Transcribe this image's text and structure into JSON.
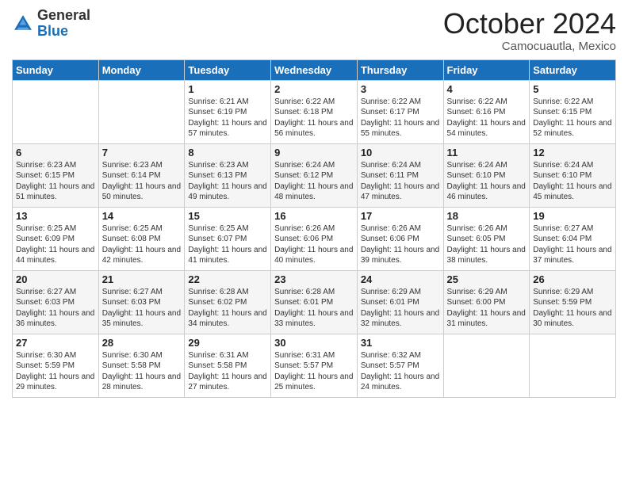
{
  "header": {
    "logo": {
      "general": "General",
      "blue": "Blue"
    },
    "month": "October 2024",
    "location": "Camocuautla, Mexico"
  },
  "weekdays": [
    "Sunday",
    "Monday",
    "Tuesday",
    "Wednesday",
    "Thursday",
    "Friday",
    "Saturday"
  ],
  "weeks": [
    [
      {
        "day": null
      },
      {
        "day": null
      },
      {
        "day": "1",
        "sunrise": "Sunrise: 6:21 AM",
        "sunset": "Sunset: 6:19 PM",
        "daylight": "Daylight: 11 hours and 57 minutes."
      },
      {
        "day": "2",
        "sunrise": "Sunrise: 6:22 AM",
        "sunset": "Sunset: 6:18 PM",
        "daylight": "Daylight: 11 hours and 56 minutes."
      },
      {
        "day": "3",
        "sunrise": "Sunrise: 6:22 AM",
        "sunset": "Sunset: 6:17 PM",
        "daylight": "Daylight: 11 hours and 55 minutes."
      },
      {
        "day": "4",
        "sunrise": "Sunrise: 6:22 AM",
        "sunset": "Sunset: 6:16 PM",
        "daylight": "Daylight: 11 hours and 54 minutes."
      },
      {
        "day": "5",
        "sunrise": "Sunrise: 6:22 AM",
        "sunset": "Sunset: 6:15 PM",
        "daylight": "Daylight: 11 hours and 52 minutes."
      }
    ],
    [
      {
        "day": "6",
        "sunrise": "Sunrise: 6:23 AM",
        "sunset": "Sunset: 6:15 PM",
        "daylight": "Daylight: 11 hours and 51 minutes."
      },
      {
        "day": "7",
        "sunrise": "Sunrise: 6:23 AM",
        "sunset": "Sunset: 6:14 PM",
        "daylight": "Daylight: 11 hours and 50 minutes."
      },
      {
        "day": "8",
        "sunrise": "Sunrise: 6:23 AM",
        "sunset": "Sunset: 6:13 PM",
        "daylight": "Daylight: 11 hours and 49 minutes."
      },
      {
        "day": "9",
        "sunrise": "Sunrise: 6:24 AM",
        "sunset": "Sunset: 6:12 PM",
        "daylight": "Daylight: 11 hours and 48 minutes."
      },
      {
        "day": "10",
        "sunrise": "Sunrise: 6:24 AM",
        "sunset": "Sunset: 6:11 PM",
        "daylight": "Daylight: 11 hours and 47 minutes."
      },
      {
        "day": "11",
        "sunrise": "Sunrise: 6:24 AM",
        "sunset": "Sunset: 6:10 PM",
        "daylight": "Daylight: 11 hours and 46 minutes."
      },
      {
        "day": "12",
        "sunrise": "Sunrise: 6:24 AM",
        "sunset": "Sunset: 6:10 PM",
        "daylight": "Daylight: 11 hours and 45 minutes."
      }
    ],
    [
      {
        "day": "13",
        "sunrise": "Sunrise: 6:25 AM",
        "sunset": "Sunset: 6:09 PM",
        "daylight": "Daylight: 11 hours and 44 minutes."
      },
      {
        "day": "14",
        "sunrise": "Sunrise: 6:25 AM",
        "sunset": "Sunset: 6:08 PM",
        "daylight": "Daylight: 11 hours and 42 minutes."
      },
      {
        "day": "15",
        "sunrise": "Sunrise: 6:25 AM",
        "sunset": "Sunset: 6:07 PM",
        "daylight": "Daylight: 11 hours and 41 minutes."
      },
      {
        "day": "16",
        "sunrise": "Sunrise: 6:26 AM",
        "sunset": "Sunset: 6:06 PM",
        "daylight": "Daylight: 11 hours and 40 minutes."
      },
      {
        "day": "17",
        "sunrise": "Sunrise: 6:26 AM",
        "sunset": "Sunset: 6:06 PM",
        "daylight": "Daylight: 11 hours and 39 minutes."
      },
      {
        "day": "18",
        "sunrise": "Sunrise: 6:26 AM",
        "sunset": "Sunset: 6:05 PM",
        "daylight": "Daylight: 11 hours and 38 minutes."
      },
      {
        "day": "19",
        "sunrise": "Sunrise: 6:27 AM",
        "sunset": "Sunset: 6:04 PM",
        "daylight": "Daylight: 11 hours and 37 minutes."
      }
    ],
    [
      {
        "day": "20",
        "sunrise": "Sunrise: 6:27 AM",
        "sunset": "Sunset: 6:03 PM",
        "daylight": "Daylight: 11 hours and 36 minutes."
      },
      {
        "day": "21",
        "sunrise": "Sunrise: 6:27 AM",
        "sunset": "Sunset: 6:03 PM",
        "daylight": "Daylight: 11 hours and 35 minutes."
      },
      {
        "day": "22",
        "sunrise": "Sunrise: 6:28 AM",
        "sunset": "Sunset: 6:02 PM",
        "daylight": "Daylight: 11 hours and 34 minutes."
      },
      {
        "day": "23",
        "sunrise": "Sunrise: 6:28 AM",
        "sunset": "Sunset: 6:01 PM",
        "daylight": "Daylight: 11 hours and 33 minutes."
      },
      {
        "day": "24",
        "sunrise": "Sunrise: 6:29 AM",
        "sunset": "Sunset: 6:01 PM",
        "daylight": "Daylight: 11 hours and 32 minutes."
      },
      {
        "day": "25",
        "sunrise": "Sunrise: 6:29 AM",
        "sunset": "Sunset: 6:00 PM",
        "daylight": "Daylight: 11 hours and 31 minutes."
      },
      {
        "day": "26",
        "sunrise": "Sunrise: 6:29 AM",
        "sunset": "Sunset: 5:59 PM",
        "daylight": "Daylight: 11 hours and 30 minutes."
      }
    ],
    [
      {
        "day": "27",
        "sunrise": "Sunrise: 6:30 AM",
        "sunset": "Sunset: 5:59 PM",
        "daylight": "Daylight: 11 hours and 29 minutes."
      },
      {
        "day": "28",
        "sunrise": "Sunrise: 6:30 AM",
        "sunset": "Sunset: 5:58 PM",
        "daylight": "Daylight: 11 hours and 28 minutes."
      },
      {
        "day": "29",
        "sunrise": "Sunrise: 6:31 AM",
        "sunset": "Sunset: 5:58 PM",
        "daylight": "Daylight: 11 hours and 27 minutes."
      },
      {
        "day": "30",
        "sunrise": "Sunrise: 6:31 AM",
        "sunset": "Sunset: 5:57 PM",
        "daylight": "Daylight: 11 hours and 25 minutes."
      },
      {
        "day": "31",
        "sunrise": "Sunrise: 6:32 AM",
        "sunset": "Sunset: 5:57 PM",
        "daylight": "Daylight: 11 hours and 24 minutes."
      },
      {
        "day": null
      },
      {
        "day": null
      }
    ]
  ]
}
